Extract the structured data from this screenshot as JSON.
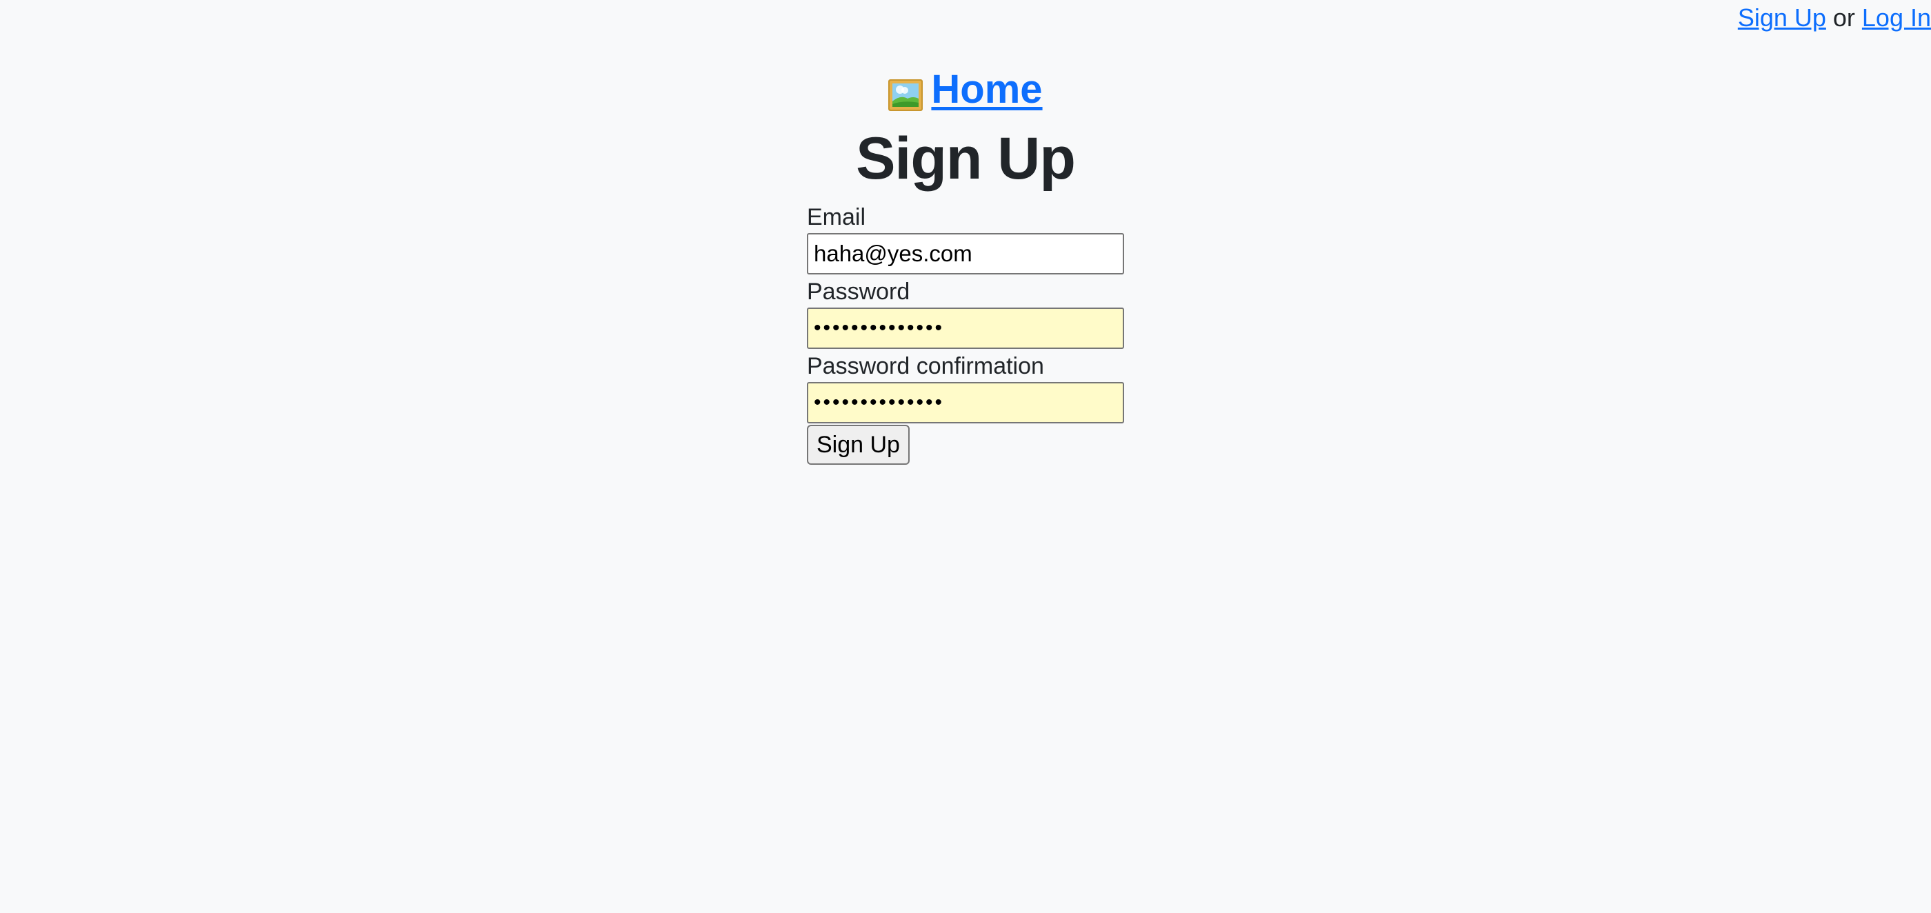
{
  "header": {
    "signup_link": "Sign Up",
    "separator": "or",
    "login_link": "Log In"
  },
  "home": {
    "icon": "framed-picture-icon",
    "label": "Home"
  },
  "page_title": "Sign Up",
  "form": {
    "email": {
      "label": "Email",
      "value": "haha@yes.com"
    },
    "password": {
      "label": "Password",
      "value": "••••••••••••••"
    },
    "password_confirmation": {
      "label": "Password confirmation",
      "value": "••••••••••••••"
    },
    "submit_label": "Sign Up"
  },
  "colors": {
    "link": "#0d6efd",
    "autofill_bg": "#fffbc9",
    "page_bg": "#f8f9fa"
  }
}
